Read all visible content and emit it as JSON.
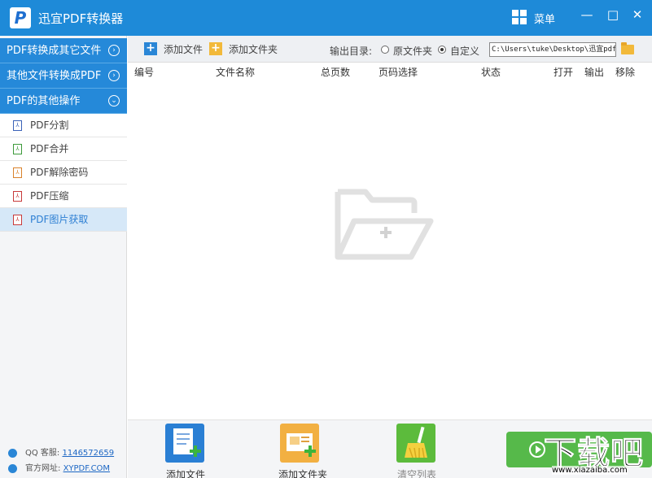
{
  "app": {
    "logo": "P",
    "title": "迅宜PDF转换器",
    "menu_label": "菜单"
  },
  "window_controls": {
    "minimize": "—",
    "maximize": "□",
    "close": "✕"
  },
  "sidebar": {
    "categories": [
      {
        "label": "PDF转换成其它文件",
        "icon": "chevron-right-circle-icon"
      },
      {
        "label": "其他文件转换成PDF",
        "icon": "chevron-right-circle-icon"
      },
      {
        "label": "PDF的其他操作",
        "icon": "chevron-down-circle-icon"
      }
    ],
    "items": [
      {
        "label": "PDF分割",
        "icon_color": "#3a62b8"
      },
      {
        "label": "PDF合并",
        "icon_color": "#3c9a3a"
      },
      {
        "label": "PDF解除密码",
        "icon_color": "#d9822b"
      },
      {
        "label": "PDF压缩",
        "icon_color": "#c83a3a"
      },
      {
        "label": "PDF图片获取",
        "icon_color": "#c83a3a"
      }
    ],
    "contact": {
      "qq_label": "QQ 客服:",
      "qq_value": "1146572659",
      "site_label": "官方网址:",
      "site_value": "XYPDF.COM"
    }
  },
  "toolbar": {
    "add_file": "添加文件",
    "add_folder": "添加文件夹",
    "output_label": "输出目录:",
    "radio_source": "原文件夹",
    "radio_custom": "自定义",
    "output_path": "C:\\Users\\tuke\\Desktop\\迅宜pdf\\功",
    "selected_radio": "自定义"
  },
  "table": {
    "columns": [
      "编号",
      "文件名称",
      "总页数",
      "页码选择",
      "状态",
      "打开",
      "输出",
      "移除"
    ]
  },
  "bottom": {
    "add_file": "添加文件",
    "add_folder": "添加文件夹",
    "clear_list": "清空列表"
  },
  "watermark": {
    "big": "下载吧",
    "small": "www.xiazaiba.com"
  },
  "colors": {
    "accent": "#1e8ad8",
    "sidebar_active": "#d6e8f8",
    "start_green": "#56b94a"
  }
}
